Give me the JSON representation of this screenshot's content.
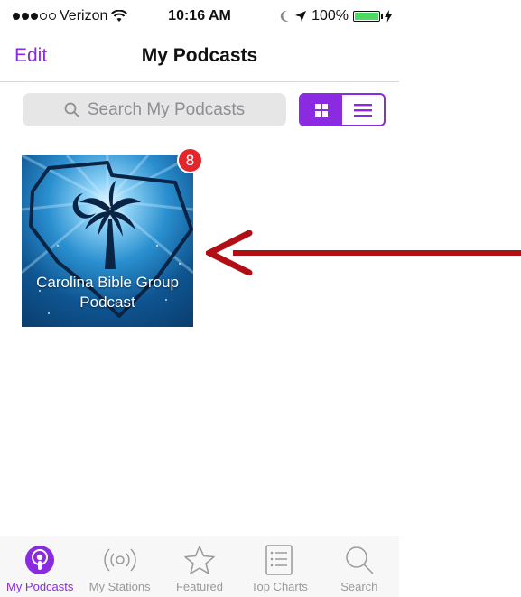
{
  "status_bar": {
    "carrier": "Verizon",
    "time": "10:16 AM",
    "battery": "100%"
  },
  "nav": {
    "edit_label": "Edit",
    "title": "My Podcasts"
  },
  "search": {
    "placeholder": "Search My Podcasts"
  },
  "view_toggle": {
    "options": [
      "grid-icon",
      "list-icon"
    ],
    "selected": "grid-icon"
  },
  "podcasts": [
    {
      "title_line1": "Carolina Bible Group",
      "title_line2": "Podcast",
      "unplayed_count": "8"
    }
  ],
  "tabs": [
    {
      "label": "My Podcasts",
      "icon": "podcast-icon",
      "active": true
    },
    {
      "label": "My Stations",
      "icon": "stations-icon",
      "active": false
    },
    {
      "label": "Featured",
      "icon": "star-icon",
      "active": false
    },
    {
      "label": "Top Charts",
      "icon": "list-chart-icon",
      "active": false
    },
    {
      "label": "Search",
      "icon": "magnifier-icon",
      "active": false
    }
  ],
  "colors": {
    "accent": "#8a2be2",
    "badge": "#e2262b",
    "annotation_arrow": "#b01015"
  }
}
